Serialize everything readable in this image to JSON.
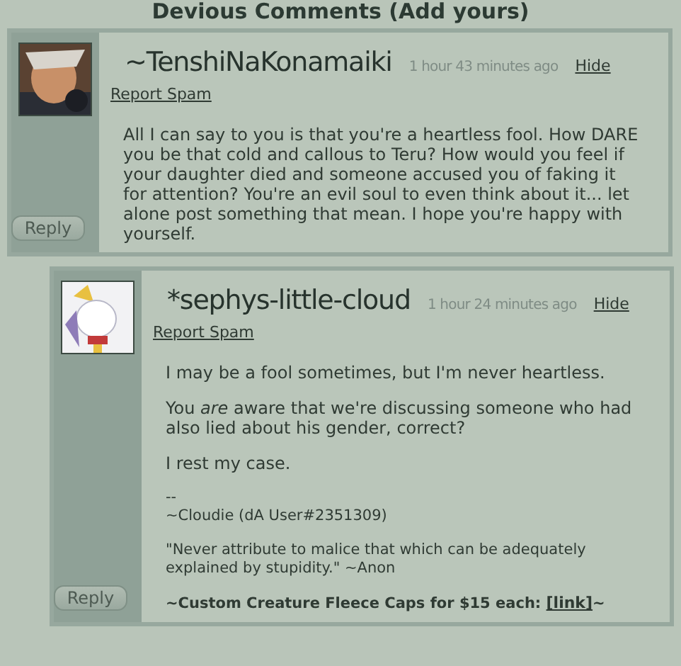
{
  "heading": "Devious Comments (Add yours)",
  "comments": [
    {
      "username": "~TenshiNaKonamaiki",
      "time": "1 hour 43 minutes ago",
      "hide": "Hide",
      "report": "Report Spam",
      "reply": "Reply",
      "avatar": {
        "kind": "picture"
      },
      "body": [
        {
          "kind": "text",
          "text": "All I can say to you is that you're a heartless fool. How DARE you be that cold and callous to Teru? How would you feel if your daughter died and someone accused you of faking it for attention? You're an evil soul to even think about it... let alone post something that mean. I hope you're happy with yourself."
        }
      ],
      "children": [
        {
          "username": "*sephys-little-cloud",
          "time": "1 hour 24 minutes ago",
          "hide": "Hide",
          "report": "Report Spam",
          "reply": "Reply",
          "avatar": {
            "kind": "picture"
          },
          "body": [
            {
              "kind": "text",
              "text": "I may be a fool sometimes, but I'm never heartless."
            },
            {
              "kind": "text",
              "text": "You *are* aware that we're discussing someone who had also lied about his gender, correct?"
            },
            {
              "kind": "text",
              "text": "I rest my case."
            },
            {
              "kind": "signature",
              "lines": [
                "--",
                "~Cloudie (dA User#2351309)"
              ]
            },
            {
              "kind": "small",
              "text": "\"Never attribute to malice that which can be adequately explained by stupidity.\" ~Anon"
            },
            {
              "kind": "promo",
              "text": "~Custom Creature Fleece Caps for $15 each: ",
              "link": "[link]",
              "after": "~"
            }
          ]
        }
      ]
    }
  ]
}
